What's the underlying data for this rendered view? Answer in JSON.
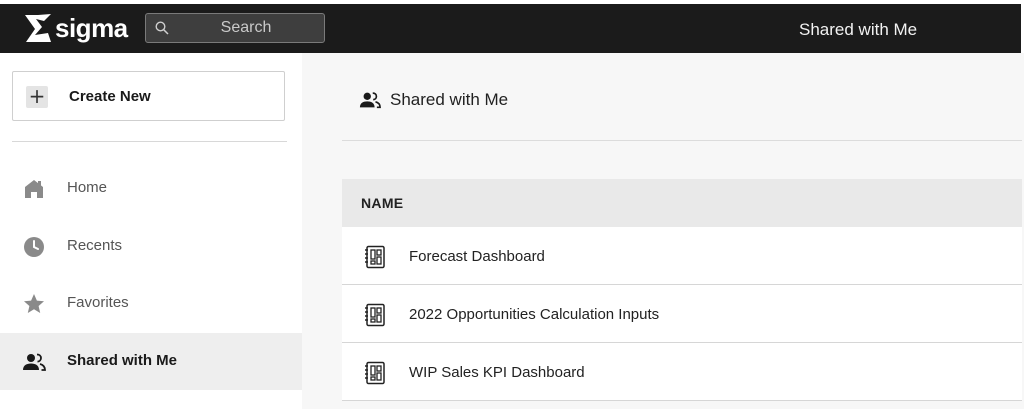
{
  "header": {
    "brand": "sigma",
    "search_placeholder": "Search",
    "page_title": "Shared with Me"
  },
  "sidebar": {
    "create_label": "Create New",
    "items": [
      {
        "label": "Home",
        "icon": "home-icon"
      },
      {
        "label": "Recents",
        "icon": "clock-icon"
      },
      {
        "label": "Favorites",
        "icon": "star-icon"
      },
      {
        "label": "Shared with Me",
        "icon": "people-icon",
        "active": true
      }
    ]
  },
  "main": {
    "title": "Shared with Me",
    "table": {
      "column_header": "NAME",
      "rows": [
        {
          "name": "Forecast Dashboard",
          "icon": "workbook-icon"
        },
        {
          "name": "2022 Opportunities Calculation Inputs",
          "icon": "workbook-icon"
        },
        {
          "name": "WIP Sales KPI Dashboard",
          "icon": "workbook-icon"
        }
      ]
    }
  },
  "colors": {
    "topbar": "#1b1b1b",
    "active_nav": "#eeeeee",
    "main_bg": "#f7f7f7",
    "table_header": "#e9e9e9"
  }
}
